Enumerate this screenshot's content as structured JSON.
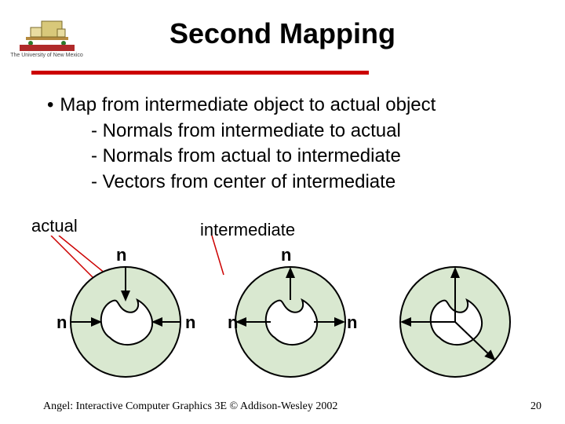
{
  "logo": {
    "caption": "The University of New Mexico"
  },
  "title": "Second Mapping",
  "body": {
    "main": "Map from intermediate object to actual object",
    "sub1": "- Normals from intermediate to actual",
    "sub2": "- Normals from actual to intermediate",
    "sub3": "- Vectors from center of intermediate"
  },
  "labels": {
    "actual": "actual",
    "intermediate": "intermediate",
    "n": "n"
  },
  "footer": "Angel: Interactive Computer Graphics 3E © Addison-Wesley 2002",
  "page": "20"
}
